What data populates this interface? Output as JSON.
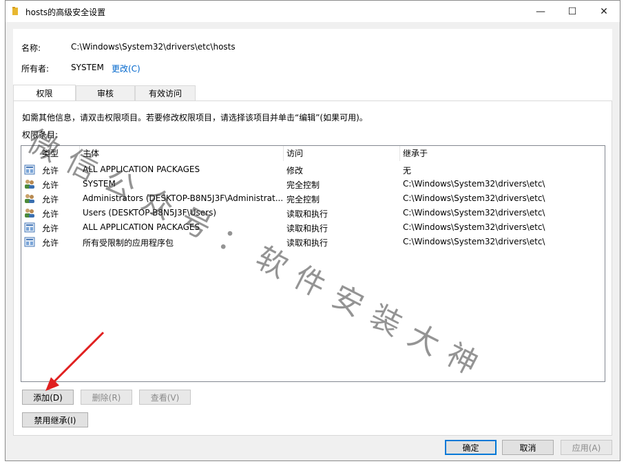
{
  "window": {
    "title": "hosts的高级安全设置",
    "minimize": "—",
    "maximize": "☐",
    "close": "✕"
  },
  "info": {
    "name_label": "名称:",
    "name_value": "C:\\Windows\\System32\\drivers\\etc\\hosts",
    "owner_label": "所有者:",
    "owner_value": "SYSTEM",
    "change_link": "更改(C)"
  },
  "tabs": [
    {
      "label": "权限"
    },
    {
      "label": "审核"
    },
    {
      "label": "有效访问"
    }
  ],
  "permissions": {
    "hint": "如需其他信息，请双击权限项目。若要修改权限项目，请选择该项目并单击“编辑”(如果可用)。",
    "entries_label": "权限条目:",
    "columns": [
      "类型",
      "主体",
      "访问",
      "继承于"
    ],
    "rows": [
      {
        "icon": "app-package-icon",
        "type": "允许",
        "principal": "ALL APPLICATION PACKAGES",
        "access": "修改",
        "inherited": "无"
      },
      {
        "icon": "users-icon",
        "type": "允许",
        "principal": "SYSTEM",
        "access": "完全控制",
        "inherited": "C:\\Windows\\System32\\drivers\\etc\\"
      },
      {
        "icon": "users-icon",
        "type": "允许",
        "principal": "Administrators (DESKTOP-B8N5J3F\\Administrat...",
        "access": "完全控制",
        "inherited": "C:\\Windows\\System32\\drivers\\etc\\"
      },
      {
        "icon": "users-icon",
        "type": "允许",
        "principal": "Users (DESKTOP-B8N5J3F\\Users)",
        "access": "读取和执行",
        "inherited": "C:\\Windows\\System32\\drivers\\etc\\"
      },
      {
        "icon": "app-package-icon",
        "type": "允许",
        "principal": "ALL APPLICATION PACKAGES",
        "access": "读取和执行",
        "inherited": "C:\\Windows\\System32\\drivers\\etc\\"
      },
      {
        "icon": "app-package-icon",
        "type": "允许",
        "principal": "所有受限制的应用程序包",
        "access": "读取和执行",
        "inherited": "C:\\Windows\\System32\\drivers\\etc\\"
      }
    ],
    "add": "添加(D)",
    "remove": "删除(R)",
    "view": "查看(V)",
    "disable_inheritance": "禁用继承(I)"
  },
  "footer": {
    "ok": "确定",
    "cancel": "取消",
    "apply": "应用(A)"
  },
  "watermark": "微信公众号：软件安装大神",
  "colors": {
    "accent": "#0078d7",
    "link": "#0066cc",
    "arrow": "#e02020"
  }
}
